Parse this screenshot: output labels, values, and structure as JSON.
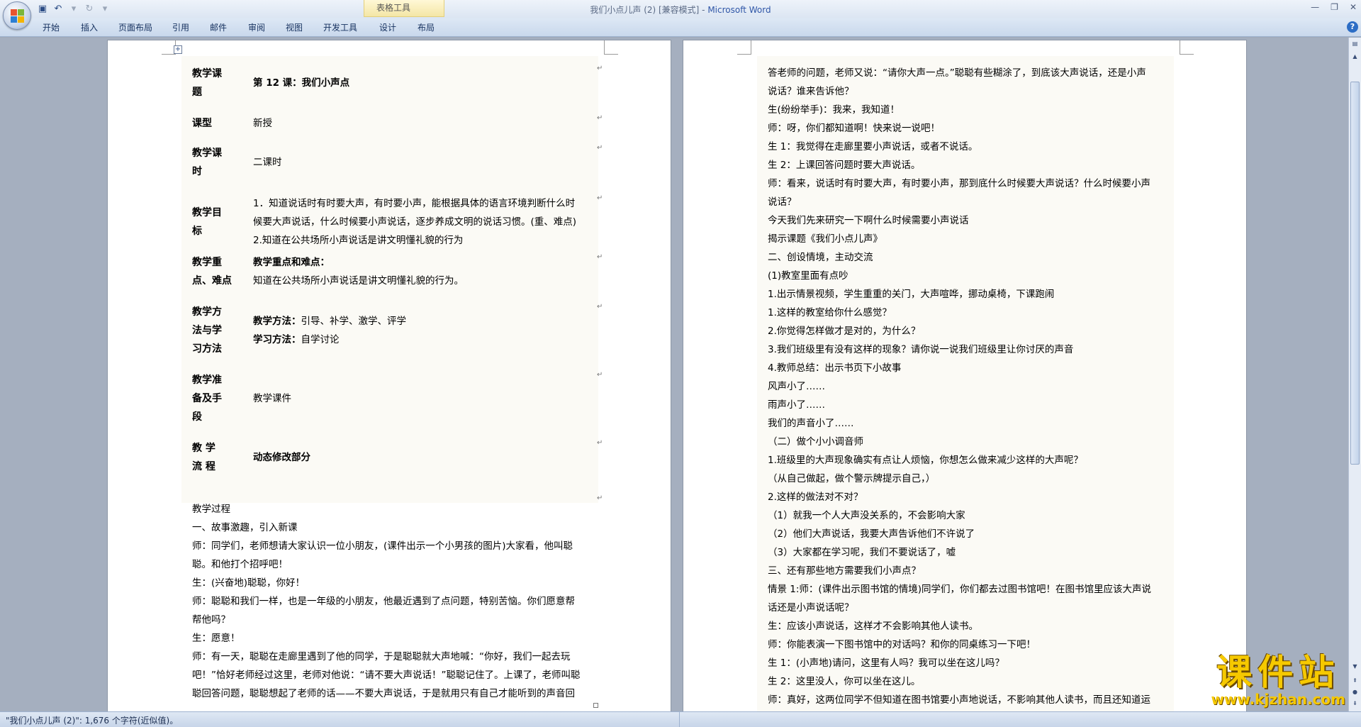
{
  "window": {
    "title": "我们小点儿声 (2) [兼容模式] - ",
    "app_name": "Microsoft Word",
    "context_tab_label": "表格工具"
  },
  "ribbon_tabs": [
    "开始",
    "插入",
    "页面布局",
    "引用",
    "邮件",
    "审阅",
    "视图",
    "开发工具",
    "设计",
    "布局"
  ],
  "icons": {
    "save": "save-icon",
    "undo": "undo-icon",
    "redo": "redo-icon",
    "customize": "customize-icon",
    "minimize": "minimize-icon",
    "restore": "restore-icon",
    "close": "close-icon",
    "help": "help-icon"
  },
  "table_rows": [
    {
      "label": "教学课\n题",
      "content": "第 12 课：我们小声点",
      "bold": true
    },
    {
      "label": "课型",
      "content": "新授"
    },
    {
      "label": "教学课\n时",
      "content": "二课时"
    },
    {
      "label": "教学目\n标",
      "content": "1．知道说话时有时要大声，有时要小声，能根据具体的语言环境判断什么时\n候要大声说话，什么时候要小声说话，逐步养成文明的说话习惯。(重、难点)\n2.知道在公共场所小声说话是讲文明懂礼貌的行为"
    },
    {
      "label": "教学重\n点、难点",
      "content_bold": "教学重点和难点：",
      "content": "知道在公共场所小声说话是讲文明懂礼貌的行为。"
    },
    {
      "label": "教学方\n法与学\n习方法",
      "method1_bold": "教学方法：",
      "method1": "引导、补学、激学、评学",
      "method2_bold": "学习方法：",
      "method2": "自学讨论"
    },
    {
      "label": "教学准\n备及手\n段",
      "content": "教学课件"
    },
    {
      "label": "教 学\n流 程",
      "content": "动态修改部分",
      "bold": true
    }
  ],
  "left_text": [
    "教学过程",
    "一、故事激趣，引入新课",
    "师：同学们，老师想请大家认识一位小朋友，(课件出示一个小男孩的图片)大家看，他叫聪",
    "聪。和他打个招呼吧！",
    "生：(兴奋地)聪聪，你好！",
    "师：聪聪和我们一样，也是一年级的小朋友，他最近遇到了点问题，特别苦恼。你们愿意帮",
    "帮他吗？",
    "生：愿意！",
    "师：有一天，聪聪在走廊里遇到了他的同学，于是聪聪就大声地喊：“你好，我们一起去玩",
    "吧！”恰好老师经过这里，老师对他说：“请不要大声说话！”聪聪记住了。上课了，老师叫聪",
    "聪回答问题，聪聪想起了老师的话——不要大声说话，于是就用只有自己才能听到的声音回"
  ],
  "right_text": [
    "答老师的问题，老师又说：“请你大声一点。”聪聪有些糊涂了，到底该大声说话，还是小声",
    "说话？谁来告诉他？",
    "生(纷纷举手)：我来，我知道！",
    "师：呀，你们都知道啊！快来说一说吧！",
    "生 1：我觉得在走廊里要小声说话，或者不说话。",
    "生 2：上课回答问题时要大声说话。",
    "师：看来，说话时有时要大声，有时要小声，那到底什么时候要大声说话？什么时候要小声",
    "说话？",
    "今天我们先来研究一下啊什么时候需要小声说话",
    "揭示课题《我们小点儿声》",
    "二、创设情境，主动交流",
    "(1)教室里面有点吵",
    "1.出示情景视频，学生重重的关门，大声喧哗，挪动桌椅，下课跑闹",
    "1.这样的教室给你什么感觉？",
    "2.你觉得怎样做才是对的，为什么？",
    "3.我们班级里有没有这样的现象？请你说一说我们班级里让你讨厌的声音",
    "4.教师总结：出示书页下小故事",
    "风声小了……",
    "雨声小了……",
    "我们的声音小了……",
    "（二）做个小小调音师",
    "1.班级里的大声现象确实有点让人烦恼，你想怎么做来减少这样的大声呢？",
    "（从自己做起，做个警示牌提示自己，）",
    "2.这样的做法对不对？",
    "（1）就我一个人大声没关系的，不会影响大家",
    "（2）他们大声说话，我要大声告诉他们不许说了",
    "（3）大家都在学习呢，我们不要说话了，嘘",
    "三、还有那些地方需要我们小声点？",
    "情景 1:师：(课件出示图书馆的情境)同学们，你们都去过图书馆吧！在图书馆里应该大声说",
    "话还是小声说话呢？",
    "生：应该小声说话，这样才不会影响其他人读书。",
    "师：你能表演一下图书馆中的对话吗？和你的同桌练习一下吧！",
    "生 1：(小声地)请问，这里有人吗？我可以坐在这儿吗？",
    "生 2：这里没人，你可以坐在这儿。",
    "师：真好，这两位同学不但知道在图书馆要小声地说话，不影响其他人读书，而且还知道运"
  ],
  "status_bar": "\"我们小点儿声 (2)\": 1,676 个字符(近似值)。",
  "watermark": {
    "title": "课件站",
    "url": "www.kjzhan.com"
  },
  "colors": {
    "accent": "#2f56a7",
    "watermark": "#f6c900"
  }
}
